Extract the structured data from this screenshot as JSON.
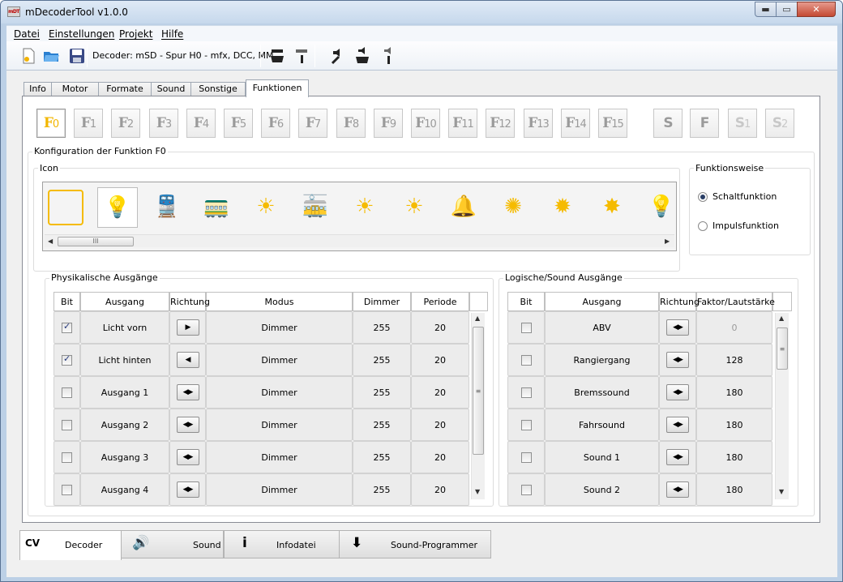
{
  "window": {
    "title": "mDecoderTool v1.0.0",
    "app_icon_text": "mDT",
    "min_glyph": "▬",
    "max_glyph": "▭",
    "close_glyph": "✕"
  },
  "menu": [
    "Datei",
    "Einstellungen",
    "Projekt",
    "Hilfe"
  ],
  "toolbar": {
    "decoder_label": "Decoder: mSD - Spur H0 - mfx, DCC, MM",
    "icons": [
      "new-file-icon",
      "open-folder-icon",
      "save-disk-icon",
      "read-decoder-icon",
      "decoder-info-icon",
      "sound-config-icon",
      "sound-read-icon",
      "sound-info-icon"
    ]
  },
  "tabs": [
    "Info",
    "Motor",
    "Formate",
    "Sound",
    "Sonstige",
    "Funktionen"
  ],
  "active_tab": "Funktionen",
  "function_buttons": [
    {
      "letter": "F",
      "sub": "0"
    },
    {
      "letter": "F",
      "sub": "1"
    },
    {
      "letter": "F",
      "sub": "2"
    },
    {
      "letter": "F",
      "sub": "3"
    },
    {
      "letter": "F",
      "sub": "4"
    },
    {
      "letter": "F",
      "sub": "5"
    },
    {
      "letter": "F",
      "sub": "6"
    },
    {
      "letter": "F",
      "sub": "7"
    },
    {
      "letter": "F",
      "sub": "8"
    },
    {
      "letter": "F",
      "sub": "9"
    },
    {
      "letter": "F",
      "sub": "10"
    },
    {
      "letter": "F",
      "sub": "11"
    },
    {
      "letter": "F",
      "sub": "12"
    },
    {
      "letter": "F",
      "sub": "13"
    },
    {
      "letter": "F",
      "sub": "14"
    },
    {
      "letter": "F",
      "sub": "15"
    }
  ],
  "special_buttons": [
    {
      "letter": "S",
      "sub": ""
    },
    {
      "letter": "F",
      "sub": ""
    },
    {
      "letter": "S",
      "sub": "1"
    },
    {
      "letter": "S",
      "sub": "2"
    }
  ],
  "config": {
    "title": "Konfiguration der Funktion F0",
    "icon_group": "Icon",
    "icons": [
      "empty-icon",
      "headlight-icon",
      "locomotive-front-icon",
      "locomotive-rear-icon",
      "ceiling-light-icon",
      "cab-light-icon",
      "lamp-icon",
      "lamp-icon",
      "bell-lamp-icon",
      "signal-lamp-icon",
      "table-lamp-icon",
      "bulb-icon",
      "headlight-icon"
    ],
    "accent_color": "#f5bb00",
    "mode_group": "Funktionsweise",
    "modes": [
      {
        "label": "Schaltfunktion",
        "selected": true
      },
      {
        "label": "Impulsfunktion",
        "selected": false
      }
    ]
  },
  "physical": {
    "title": "Physikalische Ausgänge",
    "columns": [
      "Bit",
      "Ausgang",
      "Richtung",
      "Modus",
      "Dimmer",
      "Periode"
    ],
    "rows": [
      {
        "bit": true,
        "ausgang": "Licht vorn",
        "richtung": "▶",
        "modus": "Dimmer",
        "dimmer": "255",
        "periode": "20"
      },
      {
        "bit": true,
        "ausgang": "Licht hinten",
        "richtung": "◀",
        "modus": "Dimmer",
        "dimmer": "255",
        "periode": "20"
      },
      {
        "bit": false,
        "ausgang": "Ausgang 1",
        "richtung": "◀▶",
        "modus": "Dimmer",
        "dimmer": "255",
        "periode": "20"
      },
      {
        "bit": false,
        "ausgang": "Ausgang 2",
        "richtung": "◀▶",
        "modus": "Dimmer",
        "dimmer": "255",
        "periode": "20"
      },
      {
        "bit": false,
        "ausgang": "Ausgang 3",
        "richtung": "◀▶",
        "modus": "Dimmer",
        "dimmer": "255",
        "periode": "20"
      },
      {
        "bit": false,
        "ausgang": "Ausgang 4",
        "richtung": "◀▶",
        "modus": "Dimmer",
        "dimmer": "255",
        "periode": "20"
      }
    ]
  },
  "logical": {
    "title": "Logische/Sound Ausgänge",
    "columns": [
      "Bit",
      "Ausgang",
      "Richtung",
      "Faktor/Lautstärke"
    ],
    "rows": [
      {
        "bit": false,
        "ausgang": "ABV",
        "richtung": "◀▶",
        "faktor": "0",
        "faktor_disabled": true
      },
      {
        "bit": false,
        "ausgang": "Rangiergang",
        "richtung": "◀▶",
        "faktor": "128"
      },
      {
        "bit": false,
        "ausgang": "Bremssound",
        "richtung": "◀▶",
        "faktor": "180"
      },
      {
        "bit": false,
        "ausgang": "Fahrsound",
        "richtung": "◀▶",
        "faktor": "180"
      },
      {
        "bit": false,
        "ausgang": "Sound 1",
        "richtung": "◀▶",
        "faktor": "180"
      },
      {
        "bit": false,
        "ausgang": "Sound 2",
        "richtung": "◀▶",
        "faktor": "180"
      }
    ]
  },
  "bottom_tabs": [
    {
      "label": "Decoder",
      "icon": "CV",
      "icon_name": "cv-locomotive-icon"
    },
    {
      "label": "Sound",
      "icon": "🔊",
      "icon_name": "speaker-icon"
    },
    {
      "label": "Infodatei",
      "icon": "i",
      "icon_name": "info-icon"
    },
    {
      "label": "Sound-Programmer",
      "icon": "⬇",
      "icon_name": "download-locomotive-icon"
    }
  ]
}
